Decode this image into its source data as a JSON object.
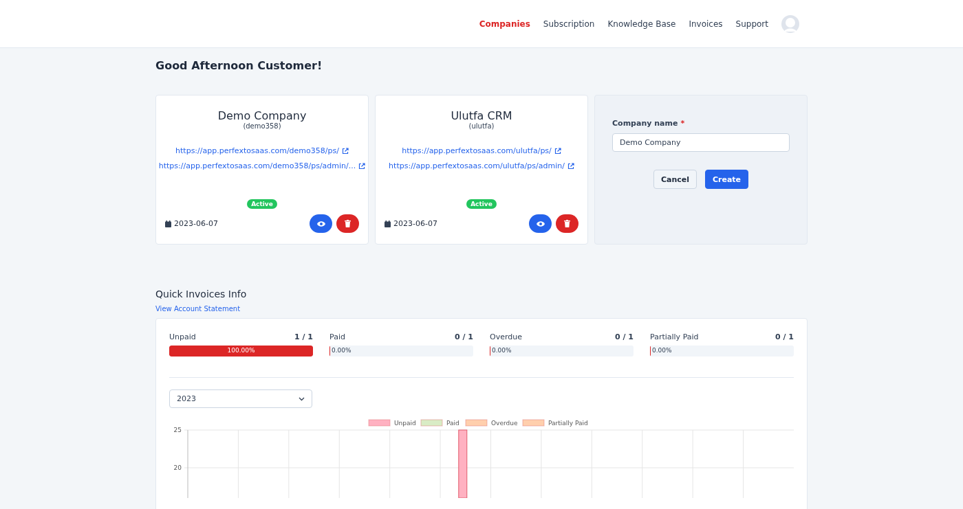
{
  "nav": {
    "items": [
      {
        "label": "Companies",
        "selected": true
      },
      {
        "label": "Subscription",
        "selected": false
      },
      {
        "label": "Knowledge Base",
        "selected": false
      },
      {
        "label": "Invoices",
        "selected": false
      },
      {
        "label": "Support",
        "selected": false
      }
    ]
  },
  "greeting": "Good Afternoon Customer!",
  "companies": [
    {
      "name": "Demo Company",
      "slug": "(demo358)",
      "links": [
        "https://app.perfextosaas.com/demo358/ps/",
        "https://app.perfextosaas.com/demo358/ps/admin/..."
      ],
      "status": "Active",
      "date": "2023-06-07"
    },
    {
      "name": "Ulutfa CRM",
      "slug": "(ulutfa)",
      "links": [
        "https://app.perfextosaas.com/ulutfa/ps/",
        "https://app.perfextosaas.com/ulutfa/ps/admin/"
      ],
      "status": "Active",
      "date": "2023-06-07"
    }
  ],
  "create_form": {
    "label": "Company name",
    "required_mark": "*",
    "value": "Demo Company",
    "buttons": [
      {
        "label": "Cancel",
        "kind": "secondary"
      },
      {
        "label": "Create",
        "kind": "primary"
      }
    ]
  },
  "invoices": {
    "title": "Quick Invoices Info",
    "link": "View Account Statement",
    "stats": [
      {
        "label": "Unpaid",
        "count": "1 / 1",
        "level": 1,
        "reading": "100.00%"
      },
      {
        "label": "Paid",
        "count": "0 / 1",
        "level": 0,
        "reading": "0.00%"
      },
      {
        "label": "Overdue",
        "count": "0 / 1",
        "level": 0,
        "reading": "0.00%"
      },
      {
        "label": "Partially Paid",
        "count": "0 / 1",
        "level": 0,
        "reading": "0.00%"
      }
    ],
    "year": "2023",
    "chart_data": {
      "type": "bar",
      "ylim": [
        16,
        25
      ],
      "yticks": [
        20,
        25
      ],
      "series": [
        {
          "name": "Unpaid",
          "color": "#ffb1c1",
          "values": [
            null,
            null,
            null,
            null,
            null,
            25,
            null,
            null,
            null,
            null,
            null,
            null
          ]
        },
        {
          "name": "Paid",
          "color": "#d9ecc5",
          "values": [
            null,
            null,
            null,
            null,
            null,
            null,
            null,
            null,
            null,
            null,
            null,
            null
          ]
        },
        {
          "name": "Overdue",
          "color": "#ffcfad",
          "values": [
            null,
            null,
            null,
            null,
            null,
            null,
            null,
            null,
            null,
            null,
            null,
            null
          ]
        },
        {
          "name": "Partially Paid",
          "color": "#ffcfad",
          "values": [
            null,
            null,
            null,
            null,
            null,
            null,
            null,
            null,
            null,
            null,
            null,
            null
          ]
        }
      ]
    }
  }
}
